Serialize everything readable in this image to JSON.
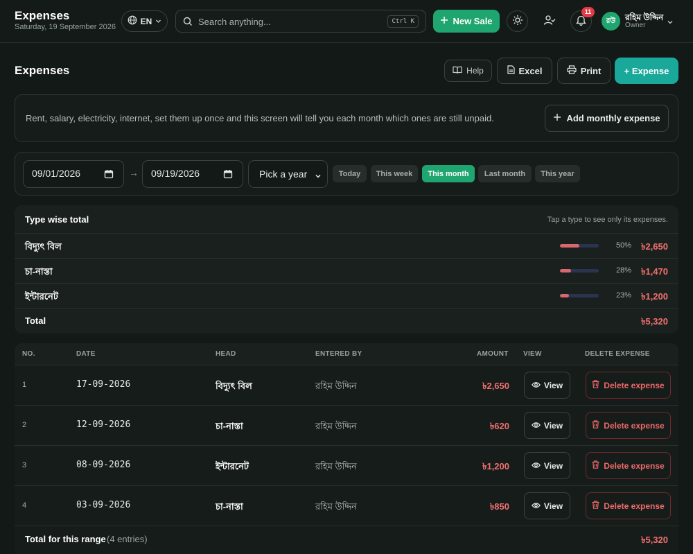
{
  "app": {
    "title": "Expenses",
    "date": "Saturday, 19 September 2026"
  },
  "topbar": {
    "language": "EN",
    "search_placeholder": "Search anything...",
    "search_shortcut": "Ctrl K",
    "new_sale_label": "New Sale",
    "notification_count": "11",
    "user": {
      "avatar_initials": "রউ",
      "name": "রহিম উদ্দিন",
      "role": "Owner"
    }
  },
  "page": {
    "title": "Expenses",
    "help_label": "Help",
    "excel_label": "Excel",
    "print_label": "Print",
    "add_expense_label": "+ Expense"
  },
  "info": {
    "text": "Rent, salary, electricity, internet, set them up once and this screen will tell you each month which ones are still unpaid.",
    "add_monthly_label": "Add monthly expense"
  },
  "filters": {
    "start_date": "2026-09-01",
    "end_date": "2026-09-19",
    "year_placeholder": "Pick a year",
    "chips": [
      {
        "label": "Today",
        "active": false
      },
      {
        "label": "This week",
        "active": false
      },
      {
        "label": "This month",
        "active": true
      },
      {
        "label": "Last month",
        "active": false
      },
      {
        "label": "This year",
        "active": false
      }
    ]
  },
  "type_totals": {
    "heading": "Type wise total",
    "hint": "Tap a type to see only its expenses.",
    "rows": [
      {
        "name": "বিদ্যুৎ বিল",
        "percent": 50,
        "percent_label": "50%",
        "amount": "৳2,650"
      },
      {
        "name": "চা-নাস্তা",
        "percent": 28,
        "percent_label": "28%",
        "amount": "৳1,470"
      },
      {
        "name": "ইন্টারনেট",
        "percent": 23,
        "percent_label": "23%",
        "amount": "৳1,200"
      }
    ],
    "total_label": "Total",
    "total_amount": "৳5,320"
  },
  "expense_table": {
    "columns": [
      "NO.",
      "DATE",
      "HEAD",
      "ENTERED BY",
      "AMOUNT",
      "VIEW",
      "DELETE EXPENSE"
    ],
    "rows": [
      {
        "no": "1",
        "date": "17-09-2026",
        "head": "বিদ্যুৎ বিল",
        "entered_by": "রহিম উদ্দিন",
        "amount": "৳2,650"
      },
      {
        "no": "2",
        "date": "12-09-2026",
        "head": "চা-নাস্তা",
        "entered_by": "রহিম উদ্দিন",
        "amount": "৳620"
      },
      {
        "no": "3",
        "date": "08-09-2026",
        "head": "ইন্টারনেট",
        "entered_by": "রহিম উদ্দিন",
        "amount": "৳1,200"
      },
      {
        "no": "4",
        "date": "03-09-2026",
        "head": "চা-নাস্তা",
        "entered_by": "রহিম উদ্দিন",
        "amount": "৳850"
      }
    ],
    "view_label": "View",
    "delete_label": "Delete expense",
    "footer_label": "Total for this range",
    "footer_count": "(4 entries)",
    "footer_amount": "৳5,320"
  },
  "icons": {
    "globe": "globe-icon",
    "search": "search-icon",
    "plus": "plus-icon",
    "sun": "sun-icon",
    "user_check": "user-check-icon",
    "bell": "bell-icon",
    "book": "book-icon",
    "file": "file-icon",
    "printer": "printer-icon",
    "calendar": "calendar-icon",
    "eye": "eye-icon",
    "trash": "trash-icon"
  },
  "colors": {
    "background": "#131917",
    "accent_green": "#1fa56f",
    "accent_teal": "#1aa89a",
    "amount_red": "#f0706e",
    "badge_red": "#e53945"
  }
}
